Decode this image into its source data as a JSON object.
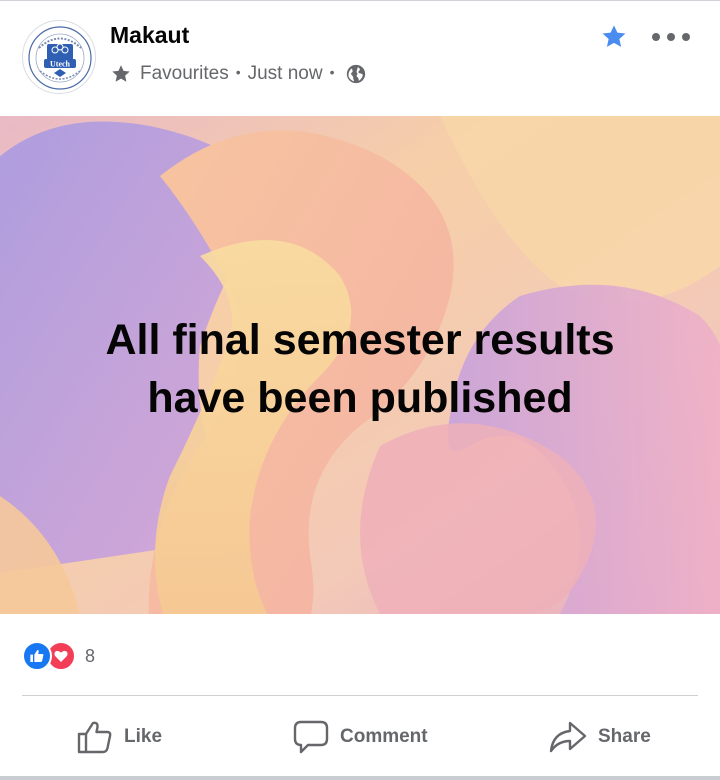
{
  "post": {
    "page_name": "Makaut",
    "meta": {
      "audience_label": "Favourites",
      "timestamp": "Just now",
      "separator": "•",
      "audience_icon": "star-icon",
      "privacy_icon": "globe-icon"
    },
    "avatar": {
      "logo_text": "Utech",
      "icon": "university-logo"
    },
    "header_actions": {
      "favourite_icon": "star-icon",
      "more_icon": "ellipsis-icon"
    },
    "media": {
      "line1": "All final semester results",
      "line2": "have been published"
    }
  },
  "reactions": {
    "icons": [
      "like-icon",
      "love-icon"
    ],
    "count": "8"
  },
  "actions": {
    "like_label": "Like",
    "comment_label": "Comment",
    "share_label": "Share"
  },
  "colors": {
    "accent": "#1877f2",
    "love": "#f33e58",
    "secondary_text": "#65676b",
    "favourite_star": "#4a8cf0"
  }
}
